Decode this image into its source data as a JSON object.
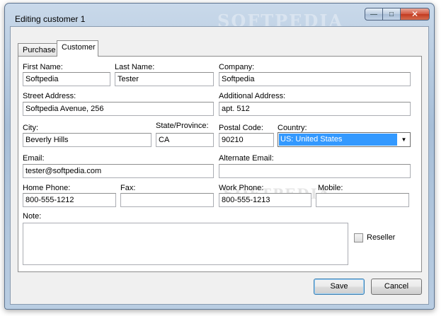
{
  "window": {
    "title": "Editing customer 1",
    "watermark": "SOFTPEDIA",
    "minimize_glyph": "—",
    "maximize_glyph": "□",
    "close_glyph": "✕"
  },
  "tabs": [
    {
      "label": "Purchase"
    },
    {
      "label": "Customer"
    }
  ],
  "form": {
    "first_name": {
      "label": "First Name:",
      "value": "Softpedia"
    },
    "last_name": {
      "label": "Last Name:",
      "value": "Tester"
    },
    "company": {
      "label": "Company:",
      "value": "Softpedia"
    },
    "street_address": {
      "label": "Street Address:",
      "value": "Softpedia Avenue, 256"
    },
    "additional_address": {
      "label": "Additional Address:",
      "value": "apt. 512"
    },
    "city": {
      "label": "City:",
      "value": "Beverly Hills"
    },
    "state": {
      "label": "State/Province:",
      "value": "CA"
    },
    "postal_code": {
      "label": "Postal Code:",
      "value": "90210"
    },
    "country": {
      "label": "Country:",
      "value": "US: United States"
    },
    "email": {
      "label": "Email:",
      "value": "tester@softpedia.com"
    },
    "alternate_email": {
      "label": "Alternate Email:",
      "value": ""
    },
    "home_phone": {
      "label": "Home Phone:",
      "value": "800-555-1212"
    },
    "fax": {
      "label": "Fax:",
      "value": ""
    },
    "work_phone": {
      "label": "Work Phone:",
      "value": "800-555-1213"
    },
    "mobile": {
      "label": "Mobile:",
      "value": ""
    },
    "note": {
      "label": "Note:",
      "value": ""
    },
    "reseller": {
      "label": "Reseller",
      "checked": false
    }
  },
  "buttons": {
    "save": "Save",
    "cancel": "Cancel"
  }
}
